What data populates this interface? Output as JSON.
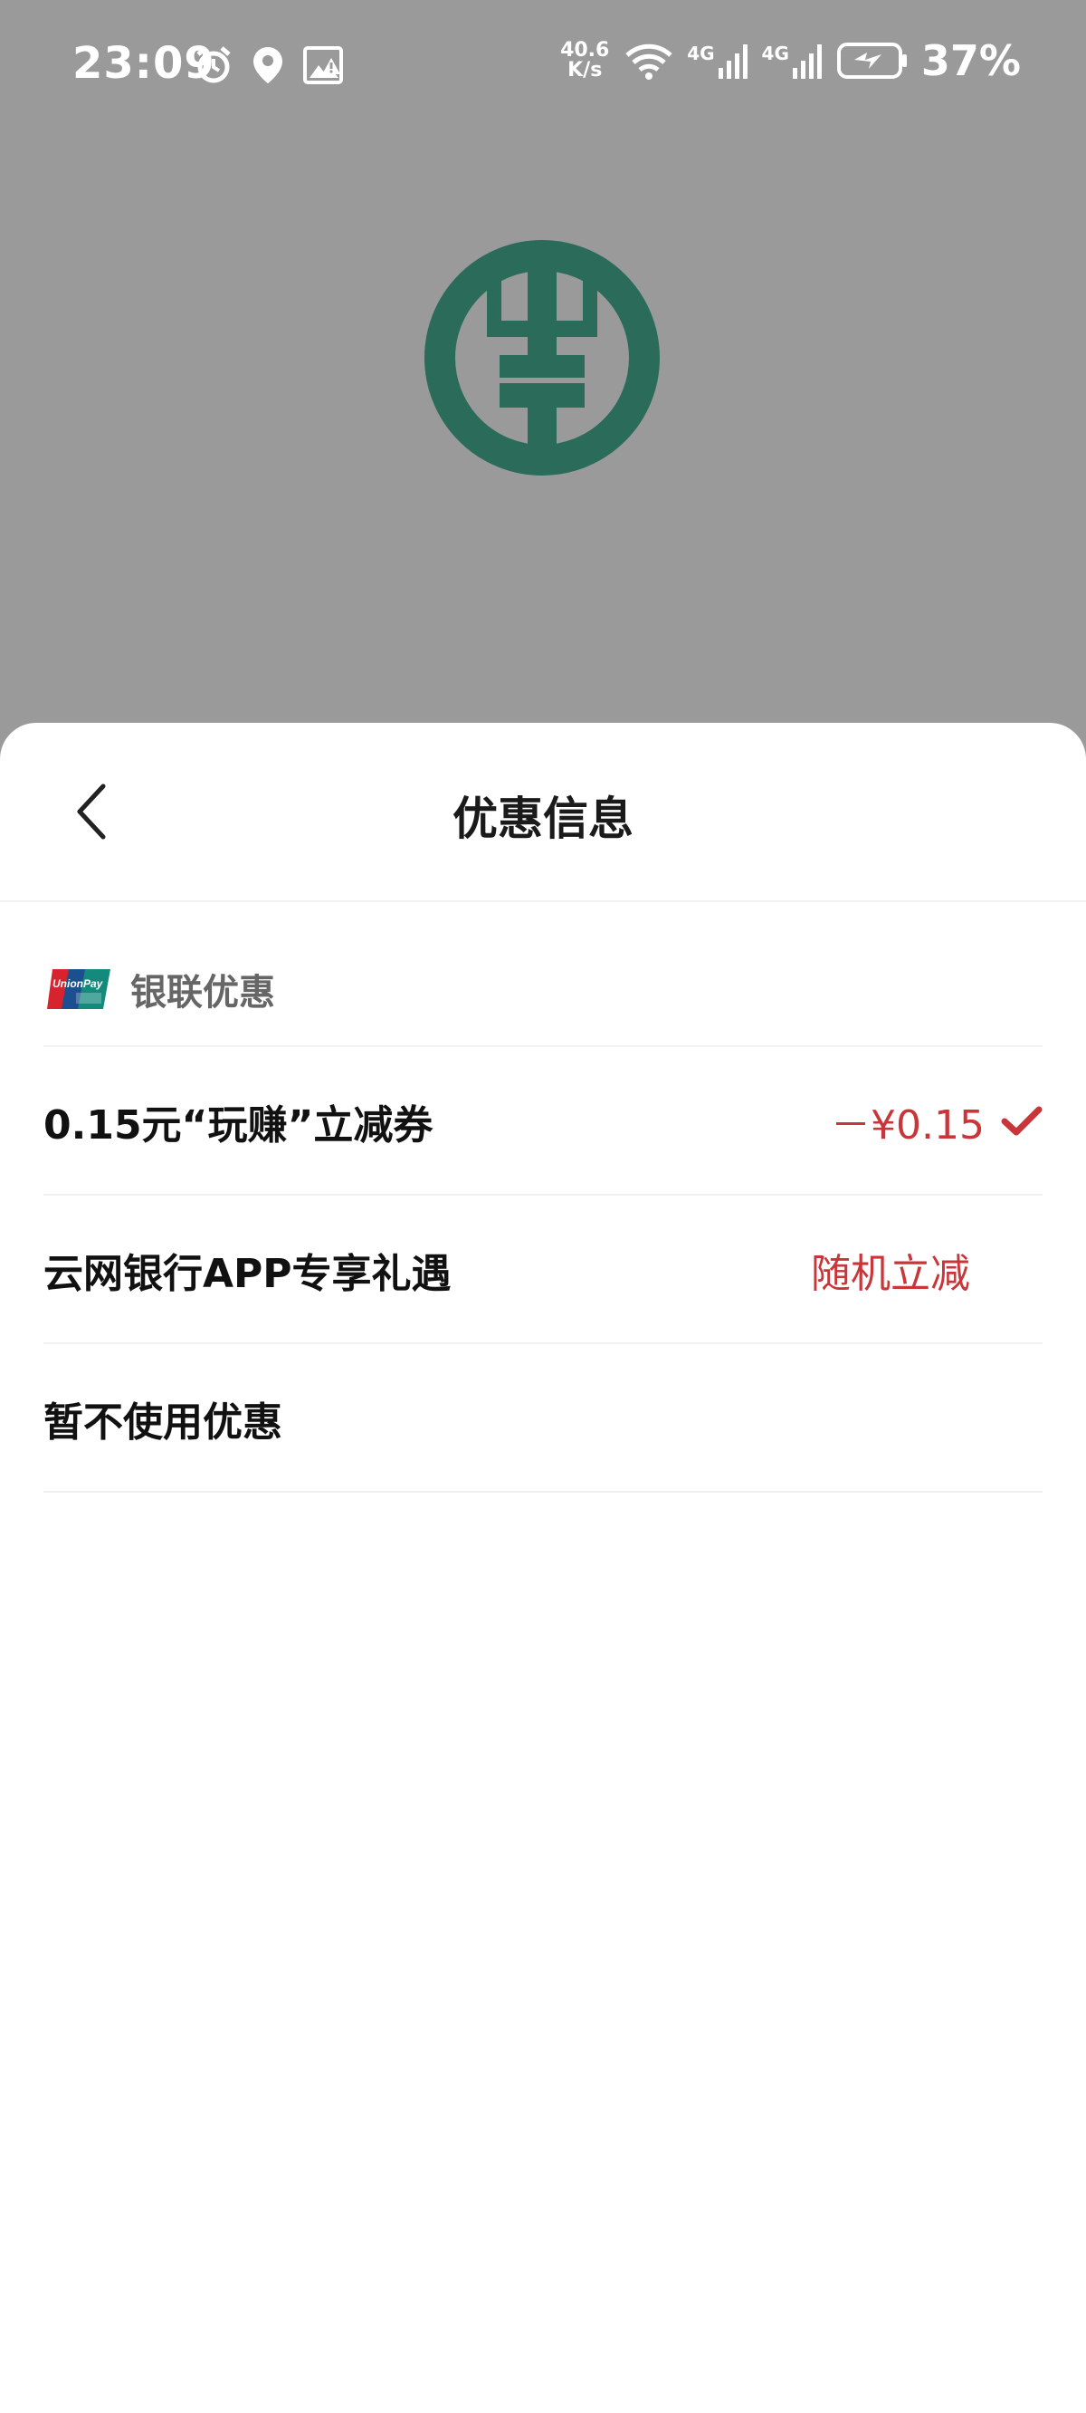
{
  "status_bar": {
    "time": "23:09",
    "net_speed_value": "40.6",
    "net_speed_unit": "K/s",
    "signal_1_label": "4G",
    "signal_2_label": "4G",
    "battery": "37%"
  },
  "sheet": {
    "title": "优惠信息",
    "section_title": "银联优惠",
    "options": [
      {
        "label": "0.15元“玩赚”立减券",
        "value": "－¥0.15",
        "selected": true
      },
      {
        "label": "云网银行APP专享礼遇",
        "value": "随机立减",
        "selected": false
      },
      {
        "label": "暂不使用优惠",
        "value": "",
        "selected": false
      }
    ]
  },
  "colors": {
    "accent": "#c8363a",
    "bank_green": "#2a6b5a",
    "overlay": "#9a9a9a"
  },
  "icons": [
    "alarm-icon",
    "location-icon",
    "image-alert-icon",
    "wifi-icon",
    "signal-icon",
    "battery-icon",
    "bank-logo",
    "unionpay-logo",
    "back-icon",
    "check-icon"
  ]
}
